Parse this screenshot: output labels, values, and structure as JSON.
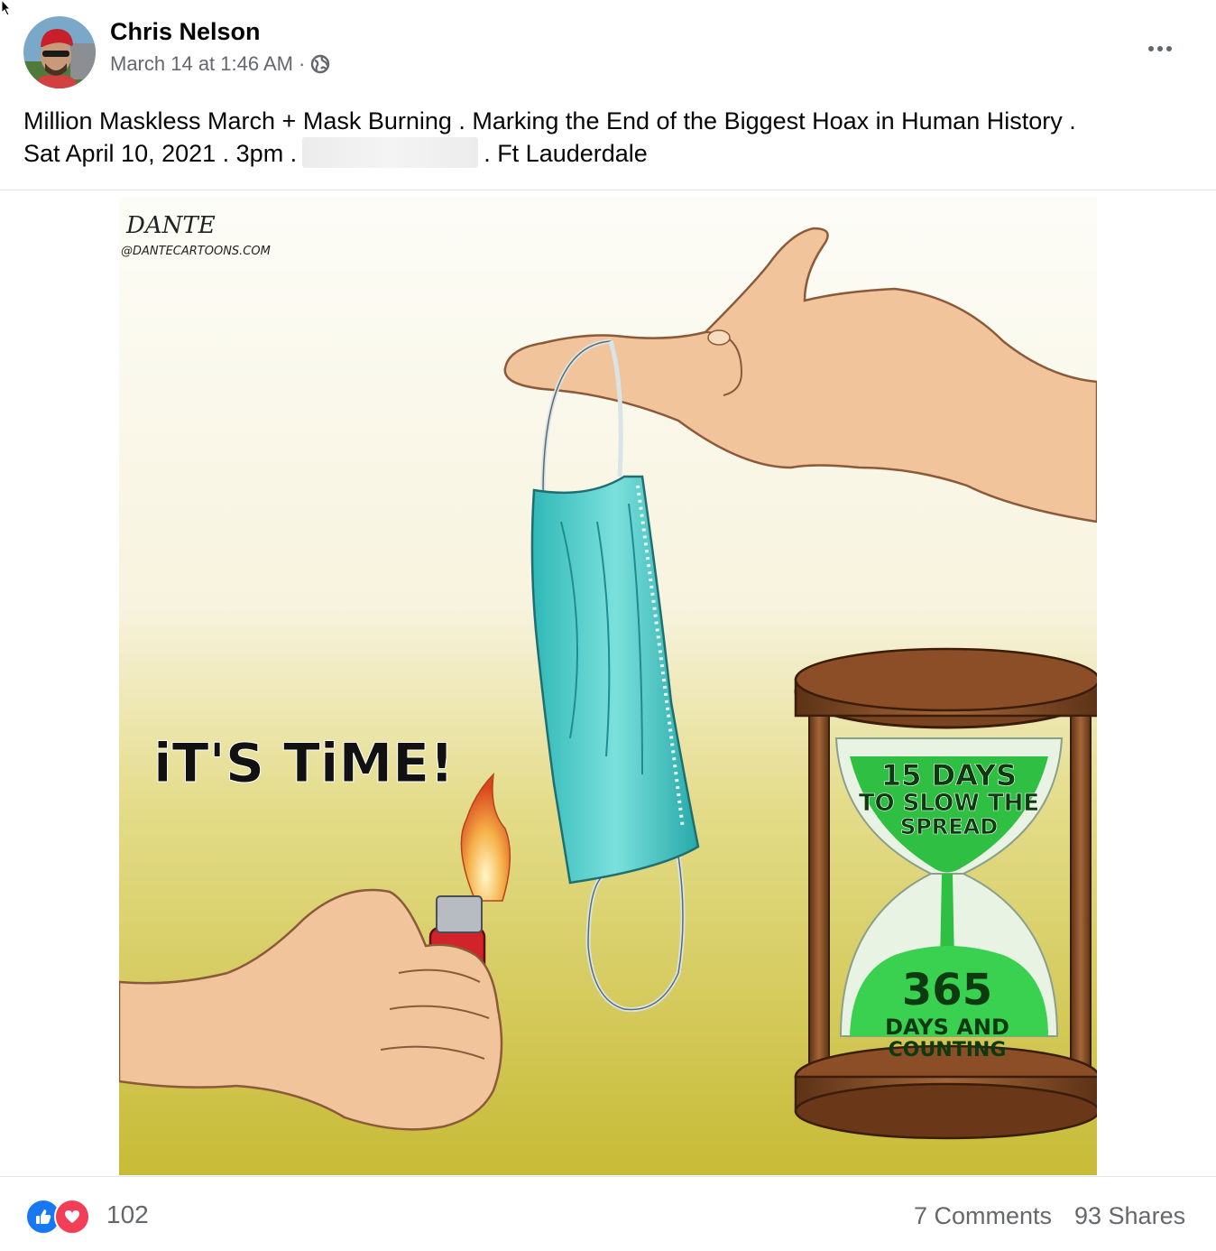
{
  "post": {
    "author": "Chris Nelson",
    "date": "March 14 at 1:46 AM",
    "separator": "·",
    "privacy_icon": "globe-icon",
    "more_icon": "more-options-icon",
    "text_line1": "Million Maskless March + Mask Burning . Marking the End of the Biggest Hoax in Human History .",
    "text_line2_start": "Sat April 10, 2021 . 3pm .",
    "text_line2_end": ". Ft Lauderdale"
  },
  "cartoon": {
    "signature": "DANTE",
    "handle": "@DANTECARTOONS.COM",
    "caption": "iT'S TiME!",
    "hourglass_top_line1": "15 DAYS",
    "hourglass_top_line2": "TO SLOW THE",
    "hourglass_top_line3": "SPREAD",
    "hourglass_bottom_number": "365",
    "hourglass_bottom_line1": "DAYS AND",
    "hourglass_bottom_line2": "COUNTING"
  },
  "footer": {
    "reaction_count": "102",
    "comments": "7 Comments",
    "shares": "93 Shares"
  },
  "colors": {
    "facebook_blue": "#1877f2",
    "love_red": "#f33e58",
    "secondary_text": "#65676b"
  }
}
